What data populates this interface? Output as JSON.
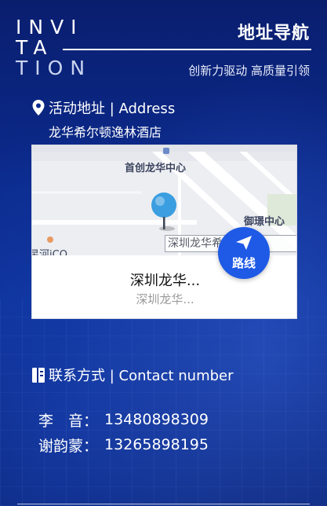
{
  "logo": {
    "lines": [
      "INVI",
      "TA",
      "TION"
    ]
  },
  "header": {
    "title": "地址导航",
    "slogan": "创新力驱动 高质量引领"
  },
  "address": {
    "heading": "活动地址 | Address",
    "icon": "location-pin-icon",
    "value": "龙华希尔顿逸林酒店"
  },
  "map": {
    "poi_main": "首创龙华中心",
    "poi_right": "御璟中心",
    "poi_left": "星河iCO",
    "poi_label": "深圳龙华希尔顿逸林",
    "place_title": "深圳龙华...",
    "place_subtitle": "深圳龙华...",
    "route_button": "路线",
    "route_icon": "navigation-arrow-icon",
    "marker_icon": "map-marker-icon"
  },
  "contact": {
    "heading": "联系方式 | Contact number",
    "icon": "phone-book-icon",
    "people": [
      {
        "name": "李　音：",
        "phone": "13480898309"
      },
      {
        "name": "谢韵蒙：",
        "phone": "13265898195"
      }
    ]
  },
  "colors": {
    "background": "#0b2a8c",
    "route_button": "#1e5ae6"
  }
}
